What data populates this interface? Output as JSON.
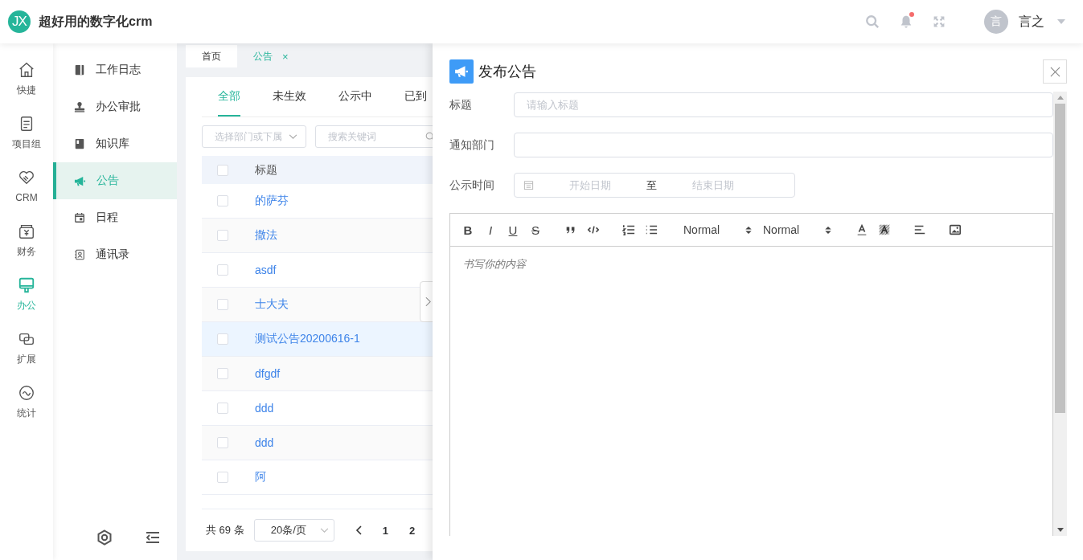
{
  "app": {
    "logo": "JX",
    "title": "超好用的数字化crm"
  },
  "header": {
    "unread": true,
    "user": {
      "avatar": "言",
      "name": "言之"
    }
  },
  "rail": [
    {
      "kind": "home",
      "label": "快捷",
      "selected": false
    },
    {
      "kind": "doc",
      "label": "项目组",
      "selected": false
    },
    {
      "kind": "heart",
      "label": "CRM",
      "selected": false
    },
    {
      "kind": "finance",
      "label": "财务",
      "selected": false
    },
    {
      "kind": "monitor",
      "label": "办公",
      "selected": true
    },
    {
      "kind": "extend",
      "label": "扩展",
      "selected": false
    },
    {
      "kind": "stats",
      "label": "统计",
      "selected": false
    }
  ],
  "submenu": [
    {
      "kind": "book",
      "label": "工作日志",
      "selected": false
    },
    {
      "kind": "stamp",
      "label": "办公审批",
      "selected": false
    },
    {
      "kind": "library",
      "label": "知识库",
      "selected": false
    },
    {
      "kind": "megaphone",
      "label": "公告",
      "selected": true
    },
    {
      "kind": "calendar",
      "label": "日程",
      "selected": false
    },
    {
      "kind": "contact",
      "label": "通讯录",
      "selected": false
    }
  ],
  "page_tabs": [
    {
      "label": "首页",
      "selected": false
    },
    {
      "label": "公告",
      "selected": true,
      "close": "×"
    }
  ],
  "status_tabs": [
    {
      "label": "全部",
      "selected": true
    },
    {
      "label": "未生效",
      "selected": false
    },
    {
      "label": "公示中",
      "selected": false
    },
    {
      "label": "已到",
      "selected": false
    }
  ],
  "filters": {
    "department": {
      "placeholder": "选择部门或下属"
    },
    "search": {
      "placeholder": "搜索关键词"
    }
  },
  "table": {
    "columns": [
      "标题"
    ],
    "all_checked": false,
    "rows": [
      {
        "title": "的萨芬",
        "checked": false,
        "highlighted": false
      },
      {
        "title": "撒法",
        "checked": false,
        "highlighted": false
      },
      {
        "title": "asdf",
        "checked": false,
        "highlighted": false
      },
      {
        "title": "士大夫",
        "checked": false,
        "highlighted": false
      },
      {
        "title": "测试公告20200616-1",
        "checked": false,
        "highlighted": true
      },
      {
        "title": "dfgdf",
        "checked": false,
        "highlighted": false
      },
      {
        "title": "ddd",
        "checked": false,
        "highlighted": false
      },
      {
        "title": "ddd",
        "checked": false,
        "highlighted": false
      },
      {
        "title": "阿",
        "checked": false,
        "highlighted": false
      }
    ]
  },
  "pagination": {
    "total": "共 69 条",
    "page_size": "20条/页",
    "pages": [
      "1",
      "2"
    ]
  },
  "drawer": {
    "title": "发布公告",
    "form": [
      {
        "kind": "text",
        "label": "标题",
        "placeholder": "请输入标题"
      },
      {
        "kind": "select",
        "label": "通知部门"
      },
      {
        "kind": "daterange",
        "label": "公示时间",
        "start_placeholder": "开始日期",
        "separator": "至",
        "end_placeholder": "结束日期"
      }
    ],
    "editor": {
      "toolbar": [
        {
          "kind": "bold",
          "glyph": "B"
        },
        {
          "kind": "italic",
          "glyph": "I"
        },
        {
          "kind": "underline",
          "glyph": "U"
        },
        {
          "kind": "strike",
          "glyph": "S"
        },
        {
          "kind": "quote"
        },
        {
          "kind": "code"
        },
        {
          "kind": "ol"
        },
        {
          "kind": "ul"
        },
        {
          "kind": "picker",
          "label": "Normal"
        },
        {
          "kind": "picker",
          "label": "Normal"
        },
        {
          "kind": "color"
        },
        {
          "kind": "background"
        },
        {
          "kind": "align"
        },
        {
          "kind": "image"
        }
      ],
      "placeholder": "书写你的内容"
    }
  }
}
